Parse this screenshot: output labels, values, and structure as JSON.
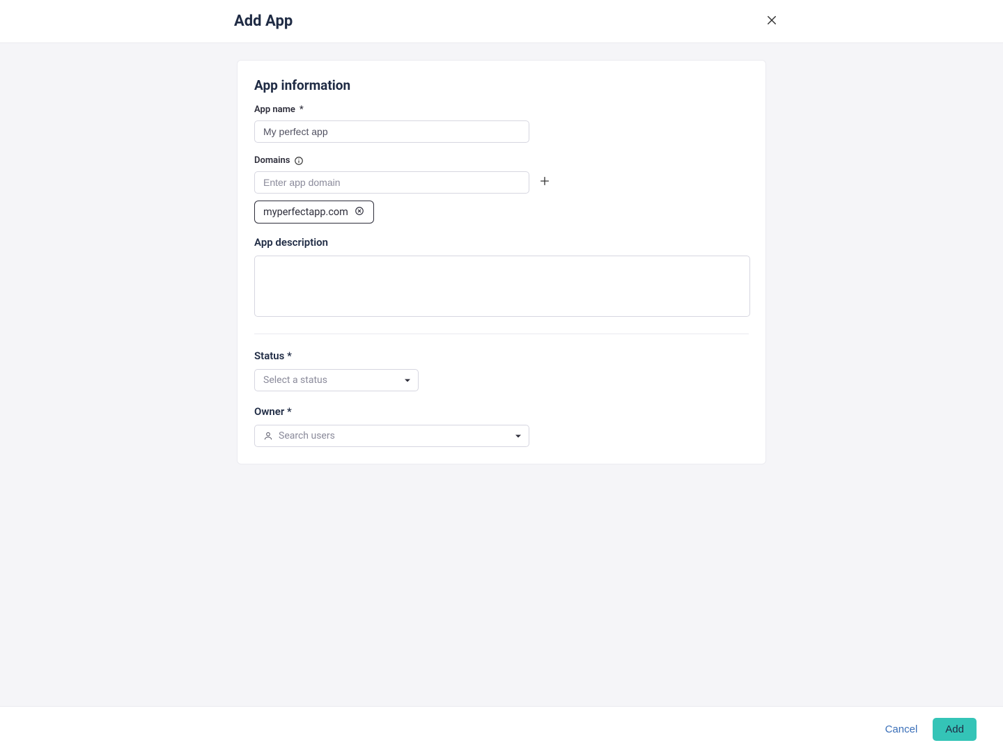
{
  "header": {
    "title": "Add App"
  },
  "card": {
    "section_title": "App information",
    "app_name": {
      "label": "App name",
      "required_marker": "*",
      "value": "My perfect app"
    },
    "domains": {
      "label": "Domains",
      "input_placeholder": "Enter app domain",
      "chips": [
        "myperfectapp.com"
      ]
    },
    "description": {
      "label": "App description",
      "value": ""
    },
    "status": {
      "label": "Status *",
      "placeholder": "Select a status"
    },
    "owner": {
      "label": "Owner *",
      "placeholder": "Search users"
    }
  },
  "footer": {
    "cancel": "Cancel",
    "add": "Add"
  }
}
